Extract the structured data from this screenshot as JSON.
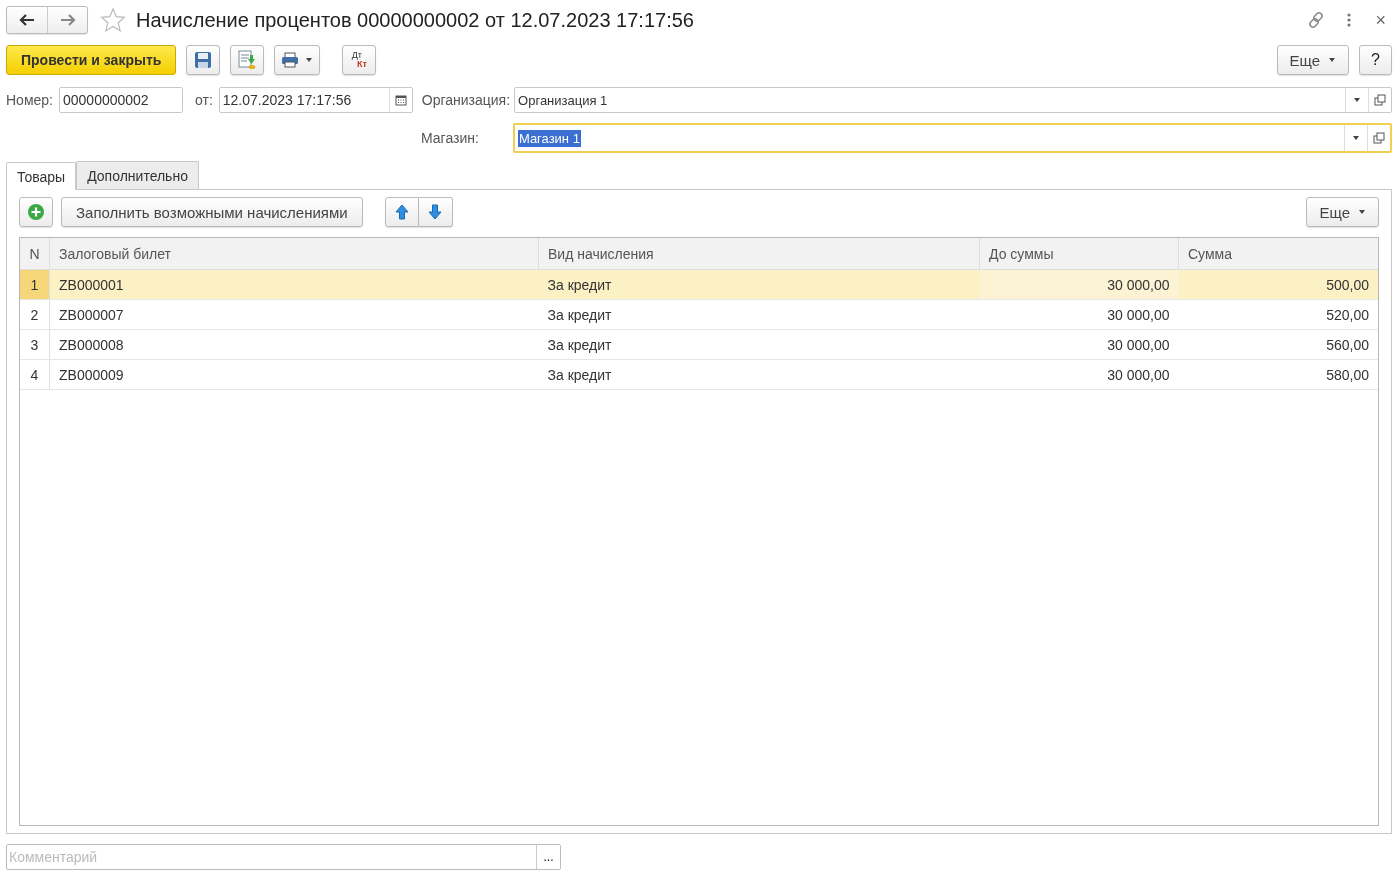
{
  "window": {
    "title": "Начисление процентов 00000000002 от 12.07.2023 17:17:56",
    "favorite": false,
    "close": "×"
  },
  "toolbar": {
    "primary": "Провести и закрыть",
    "dt_kt": [
      "Дт",
      "Кт"
    ],
    "more": "Еще",
    "help": "?"
  },
  "fields": [
    {
      "kind": "text",
      "label": "Номер:",
      "value": "00000000002"
    },
    {
      "kind": "date",
      "label": "от:",
      "value": "12.07.2023 17:17:56"
    },
    {
      "kind": "select",
      "label": "Организация:",
      "value": "Организация 1",
      "focused": false
    },
    {
      "kind": "select",
      "label": "Магазин:",
      "value": "Магазин 1",
      "focused": true
    }
  ],
  "tabs": [
    {
      "label": "Товары",
      "selected": true
    },
    {
      "label": "Дополнительно",
      "selected": false
    }
  ],
  "table_toolbar": {
    "fill": "Заполнить возможными начислениями",
    "more": "Еще"
  },
  "table": {
    "columns": [
      "N",
      "Залоговый билет",
      "Вид начисления",
      "До суммы",
      "Сумма"
    ],
    "rows": [
      {
        "cells": [
          "1",
          "ZB000001",
          "За кредит",
          "30 000,00",
          "500,00"
        ],
        "selected": true
      },
      {
        "cells": [
          "2",
          "ZB000007",
          "За кредит",
          "30 000,00",
          "520,00"
        ],
        "selected": false
      },
      {
        "cells": [
          "3",
          "ZB000008",
          "За кредит",
          "30 000,00",
          "560,00"
        ],
        "selected": false
      },
      {
        "cells": [
          "4",
          "ZB000009",
          "За кредит",
          "30 000,00",
          "580,00"
        ],
        "selected": false
      }
    ]
  },
  "comment": {
    "placeholder": "Комментарий",
    "button": "..."
  }
}
